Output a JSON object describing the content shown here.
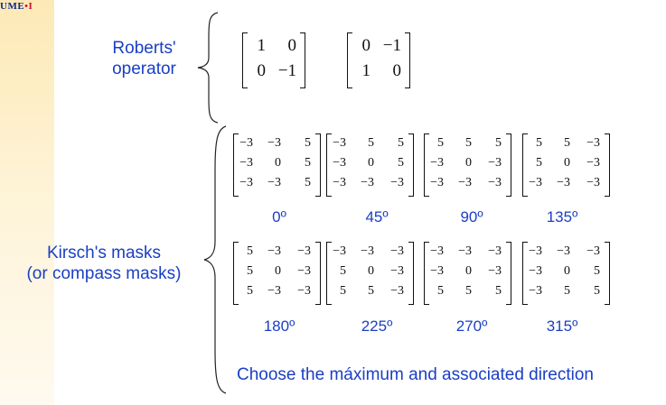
{
  "logo": {
    "text": "UME",
    "mark": "•I"
  },
  "roberts": {
    "label_line1": "Roberts'",
    "label_line2": "operator",
    "matrices": [
      [
        [
          "1",
          "0"
        ],
        [
          "0",
          "−1"
        ]
      ],
      [
        [
          "0",
          "−1"
        ],
        [
          "1",
          "0"
        ]
      ]
    ]
  },
  "kirsch": {
    "label_line1": "Kirsch's masks",
    "label_line2": "(or compass masks)",
    "rows": [
      {
        "matrices": [
          [
            [
              "−3",
              "−3",
              "5"
            ],
            [
              "−3",
              "0",
              "5"
            ],
            [
              "−3",
              "−3",
              "5"
            ]
          ],
          [
            [
              "−3",
              "5",
              "5"
            ],
            [
              "−3",
              "0",
              "5"
            ],
            [
              "−3",
              "−3",
              "−3"
            ]
          ],
          [
            [
              "5",
              "5",
              "5"
            ],
            [
              "−3",
              "0",
              "−3"
            ],
            [
              "−3",
              "−3",
              "−3"
            ]
          ],
          [
            [
              "5",
              "5",
              "−3"
            ],
            [
              "5",
              "0",
              "−3"
            ],
            [
              "−3",
              "−3",
              "−3"
            ]
          ]
        ],
        "angles": [
          "0º",
          "45º",
          "90º",
          "135º"
        ]
      },
      {
        "matrices": [
          [
            [
              "5",
              "−3",
              "−3"
            ],
            [
              "5",
              "0",
              "−3"
            ],
            [
              "5",
              "−3",
              "−3"
            ]
          ],
          [
            [
              "−3",
              "−3",
              "−3"
            ],
            [
              "5",
              "0",
              "−3"
            ],
            [
              "5",
              "5",
              "−3"
            ]
          ],
          [
            [
              "−3",
              "−3",
              "−3"
            ],
            [
              "−3",
              "0",
              "−3"
            ],
            [
              "5",
              "5",
              "5"
            ]
          ],
          [
            [
              "−3",
              "−3",
              "−3"
            ],
            [
              "−3",
              "0",
              "5"
            ],
            [
              "−3",
              "5",
              "5"
            ]
          ]
        ],
        "angles": [
          "180º",
          "225º",
          "270º",
          "315º"
        ]
      }
    ],
    "footer": "Choose the máximum and associated direction"
  }
}
